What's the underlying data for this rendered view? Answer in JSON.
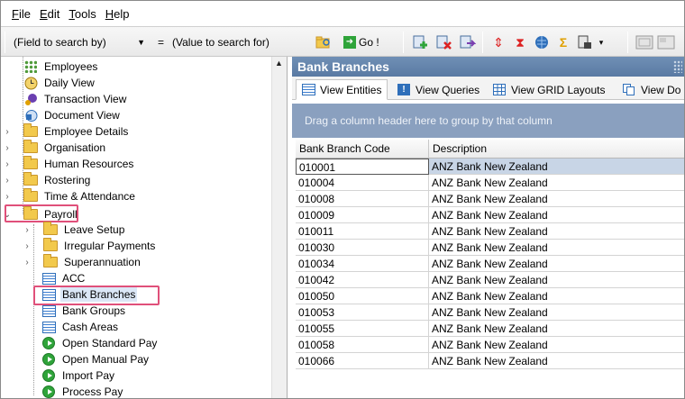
{
  "menu": [
    {
      "label": "File",
      "key": "F",
      "rest": "ile"
    },
    {
      "label": "Edit",
      "key": "E",
      "rest": "dit"
    },
    {
      "label": "Tools",
      "key": "T",
      "rest": "ools"
    },
    {
      "label": "Help",
      "key": "H",
      "rest": "elp"
    }
  ],
  "toolbar": {
    "field_select": "(Field to search by)",
    "equals": "=",
    "value_input": "(Value to search for)",
    "go_label": "Go !",
    "icons": [
      "green-plus-icon",
      "red-x-icon",
      "export-icon",
      "sort-icon",
      "hourglass-icon",
      "globe-icon",
      "sigma-icon",
      "report-icon"
    ]
  },
  "tree": {
    "items": [
      {
        "label": "Employees",
        "icon": "dots-icon",
        "level": 1
      },
      {
        "label": "Daily View",
        "icon": "clock-icon",
        "level": 1
      },
      {
        "label": "Transaction View",
        "icon": "transaction-icon",
        "level": 1
      },
      {
        "label": "Document View",
        "icon": "document-icon",
        "level": 1
      },
      {
        "label": "Employee Details",
        "icon": "folder-icon",
        "level": 1
      },
      {
        "label": "Organisation",
        "icon": "folder-icon",
        "level": 1
      },
      {
        "label": "Human Resources",
        "icon": "folder-icon",
        "level": 1
      },
      {
        "label": "Rostering",
        "icon": "folder-icon",
        "level": 1
      },
      {
        "label": "Time & Attendance",
        "icon": "folder-icon",
        "level": 1
      },
      {
        "label": "Payroll",
        "icon": "folder-open-icon",
        "level": 1
      },
      {
        "label": "Leave Setup",
        "icon": "folder-icon",
        "level": 2
      },
      {
        "label": "Irregular Payments",
        "icon": "folder-icon",
        "level": 2
      },
      {
        "label": "Superannuation",
        "icon": "folder-icon",
        "level": 2
      },
      {
        "label": "ACC",
        "icon": "grid-icon",
        "level": 2
      },
      {
        "label": "Bank Branches",
        "icon": "grid-icon",
        "level": 2
      },
      {
        "label": "Bank Groups",
        "icon": "grid-icon",
        "level": 2
      },
      {
        "label": "Cash Areas",
        "icon": "grid-icon",
        "level": 2
      },
      {
        "label": "Open Standard Pay",
        "icon": "play-icon",
        "level": 2
      },
      {
        "label": "Open Manual Pay",
        "icon": "play-icon",
        "level": 2
      },
      {
        "label": "Import Pay",
        "icon": "play-icon",
        "level": 2
      },
      {
        "label": "Process Pay",
        "icon": "play-icon",
        "level": 2
      }
    ]
  },
  "panel": {
    "title": "Bank Branches",
    "tabs": [
      "View Entities",
      "View Queries",
      "View GRID Layouts",
      "View Do"
    ],
    "group_hint": "Drag a column header here to group by that column",
    "columns": [
      "Bank Branch Code",
      "Description"
    ],
    "rows": [
      [
        "010001",
        "ANZ Bank New Zealand"
      ],
      [
        "010004",
        "ANZ Bank New Zealand"
      ],
      [
        "010008",
        "ANZ Bank New Zealand"
      ],
      [
        "010009",
        "ANZ Bank New Zealand"
      ],
      [
        "010011",
        "ANZ Bank New Zealand"
      ],
      [
        "010030",
        "ANZ Bank New Zealand"
      ],
      [
        "010034",
        "ANZ Bank New Zealand"
      ],
      [
        "010042",
        "ANZ Bank New Zealand"
      ],
      [
        "010050",
        "ANZ Bank New Zealand"
      ],
      [
        "010053",
        "ANZ Bank New Zealand"
      ],
      [
        "010055",
        "ANZ Bank New Zealand"
      ],
      [
        "010058",
        "ANZ Bank New Zealand"
      ],
      [
        "010066",
        "ANZ Bank New Zealand"
      ]
    ]
  },
  "colors": {
    "title_bar": "#5f7fa8",
    "group_area": "#8aa0bf",
    "highlight": "#e0507a",
    "selected_row": "#c8d5e6"
  }
}
